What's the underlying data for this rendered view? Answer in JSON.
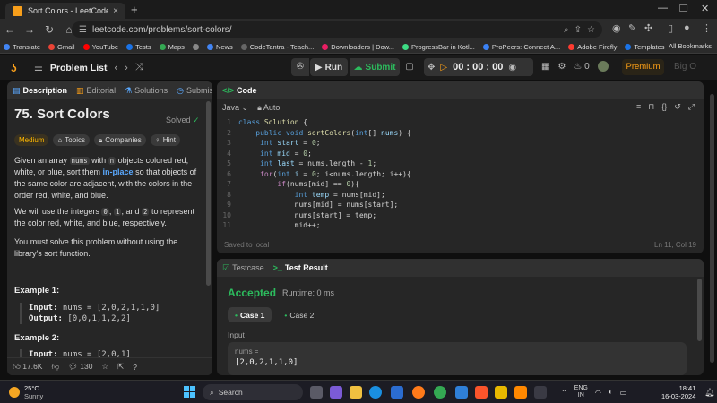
{
  "browser": {
    "tab_title": "Sort Colors - LeetCode",
    "tab_close": "×",
    "new_tab": "+",
    "url": "leetcode.com/problems/sort-colors/",
    "bookmarks": [
      {
        "label": "Translate",
        "color": "#4285f4"
      },
      {
        "label": "Gmail",
        "color": "#ea4335"
      },
      {
        "label": "YouTube",
        "color": "#ff0000"
      },
      {
        "label": "Tests",
        "color": "#1a73e8"
      },
      {
        "label": "Maps",
        "color": "#34a853"
      },
      {
        "label": "",
        "color": "#888888"
      },
      {
        "label": "News",
        "color": "#4285f4"
      },
      {
        "label": "CodeTantra - Teach...",
        "color": "#666666"
      },
      {
        "label": "Downloaders | Dow...",
        "color": "#e91e63"
      },
      {
        "label": "ProgressBar in Kotl...",
        "color": "#3ddc84"
      },
      {
        "label": "ProPeers: Connect A...",
        "color": "#3b82f6"
      },
      {
        "label": "Adobe Firefly",
        "color": "#ff3b30"
      },
      {
        "label": "Templates",
        "color": "#1a73e8"
      }
    ],
    "all_bookmarks": "All Bookmarks"
  },
  "lc": {
    "problem_list": "Problem List",
    "run": "Run",
    "submit": "Submit",
    "timer": "00 : 00 : 00",
    "streak": "0",
    "premium": "Premium",
    "bigo": "Big O"
  },
  "left": {
    "tabs": [
      "Description",
      "Editorial",
      "Solutions",
      "Submissio"
    ],
    "title": "75. Sort Colors",
    "solved": "Solved",
    "tags": [
      "Medium",
      "Topics",
      "Companies",
      "Hint"
    ],
    "p1_a": "Given an array ",
    "p1_code": "nums",
    "p1_b": " with ",
    "p1_n": "n",
    "p1_c": " objects colored red, white, or blue, sort them ",
    "p1_hl": "in-place",
    "p1_d": " so that objects of the same color are adjacent, with the colors in the order red, white, and blue.",
    "p2_a": "We will use the integers ",
    "p2_0": "0",
    "p2_b": ", ",
    "p2_1": "1",
    "p2_c": ", and ",
    "p2_2": "2",
    "p2_d": " to represent the color red, white, and blue, respectively.",
    "p3": "You must solve this problem without using the library's sort function.",
    "ex1_head": "Example 1:",
    "ex1_in_lbl": "Input:",
    "ex1_in": " nums = [2,0,2,1,1,0]",
    "ex1_out_lbl": "Output:",
    "ex1_out": " [0,0,1,1,2,2]",
    "ex2_head": "Example 2:",
    "ex2_in_lbl": "Input:",
    "ex2_in": " nums = [2,0,1]",
    "likes": "17.6K",
    "comments": "130"
  },
  "code": {
    "tab": "Code",
    "lang": "Java",
    "auto": "Auto",
    "lines": [
      {
        "n": "1",
        "html": "<span class='ty'>class</span> <span class='fn'>Solution</span> <span class='tx'>{</span>"
      },
      {
        "n": "2",
        "html": "    <span class='ty'>public</span> <span class='ty'>void</span> <span class='fn'>sortColors</span><span class='tx'>(</span><span class='ty'>int</span><span class='tx'>[] </span><span class='vr'>nums</span><span class='tx'>) {</span>"
      },
      {
        "n": "3",
        "html": "     <span class='ty'>int</span> <span class='vr'>start</span> <span class='tx'>= </span><span class='nm'>0</span><span class='tx'>;</span>"
      },
      {
        "n": "4",
        "html": "     <span class='ty'>int</span> <span class='vr'>mid</span> <span class='tx'>= </span><span class='nm'>0</span><span class='tx'>;</span>"
      },
      {
        "n": "5",
        "html": "     <span class='ty'>int</span> <span class='vr'>last</span> <span class='tx'>= nums.length - </span><span class='nm'>1</span><span class='tx'>;</span>"
      },
      {
        "n": "6",
        "html": "     <span class='kw'>for</span><span class='tx'>(</span><span class='ty'>int</span> <span class='vr'>i</span> <span class='tx'>= </span><span class='nm'>0</span><span class='tx'>; i&lt;nums.length; i++){</span>"
      },
      {
        "n": "7",
        "html": "         <span class='kw'>if</span><span class='tx'>(nums[mid] == </span><span class='nm'>0</span><span class='tx'>){</span>"
      },
      {
        "n": "8",
        "html": "             <span class='ty'>int</span> <span class='vr'>temp</span> <span class='tx'>= nums[mid];</span>"
      },
      {
        "n": "9",
        "html": "             <span class='tx'>nums[mid] = nums[start];</span>"
      },
      {
        "n": "10",
        "html": "             <span class='tx'>nums[start] = temp;</span>"
      },
      {
        "n": "11",
        "html": "             <span class='tx'>mid++;</span>"
      },
      {
        "n": "12",
        "html": "             <span class='tx'>start++;</span>"
      },
      {
        "n": "13",
        "html": "         <span class='tx'>}</span>"
      }
    ],
    "saved": "Saved to local",
    "cursor": "Ln 11, Col 19"
  },
  "test": {
    "tabs": [
      "Testcase",
      "Test Result"
    ],
    "status": "Accepted",
    "runtime": "Runtime: 0 ms",
    "cases": [
      "Case 1",
      "Case 2"
    ],
    "input_label": "Input",
    "var": "nums =",
    "value": "[2,0,2,1,1,0]"
  },
  "taskbar": {
    "temp": "25°C",
    "weather": "Sunny",
    "search": "Search",
    "lang1": "ENG",
    "lang2": "IN",
    "time": "18:41",
    "date": "16-03-2024"
  }
}
